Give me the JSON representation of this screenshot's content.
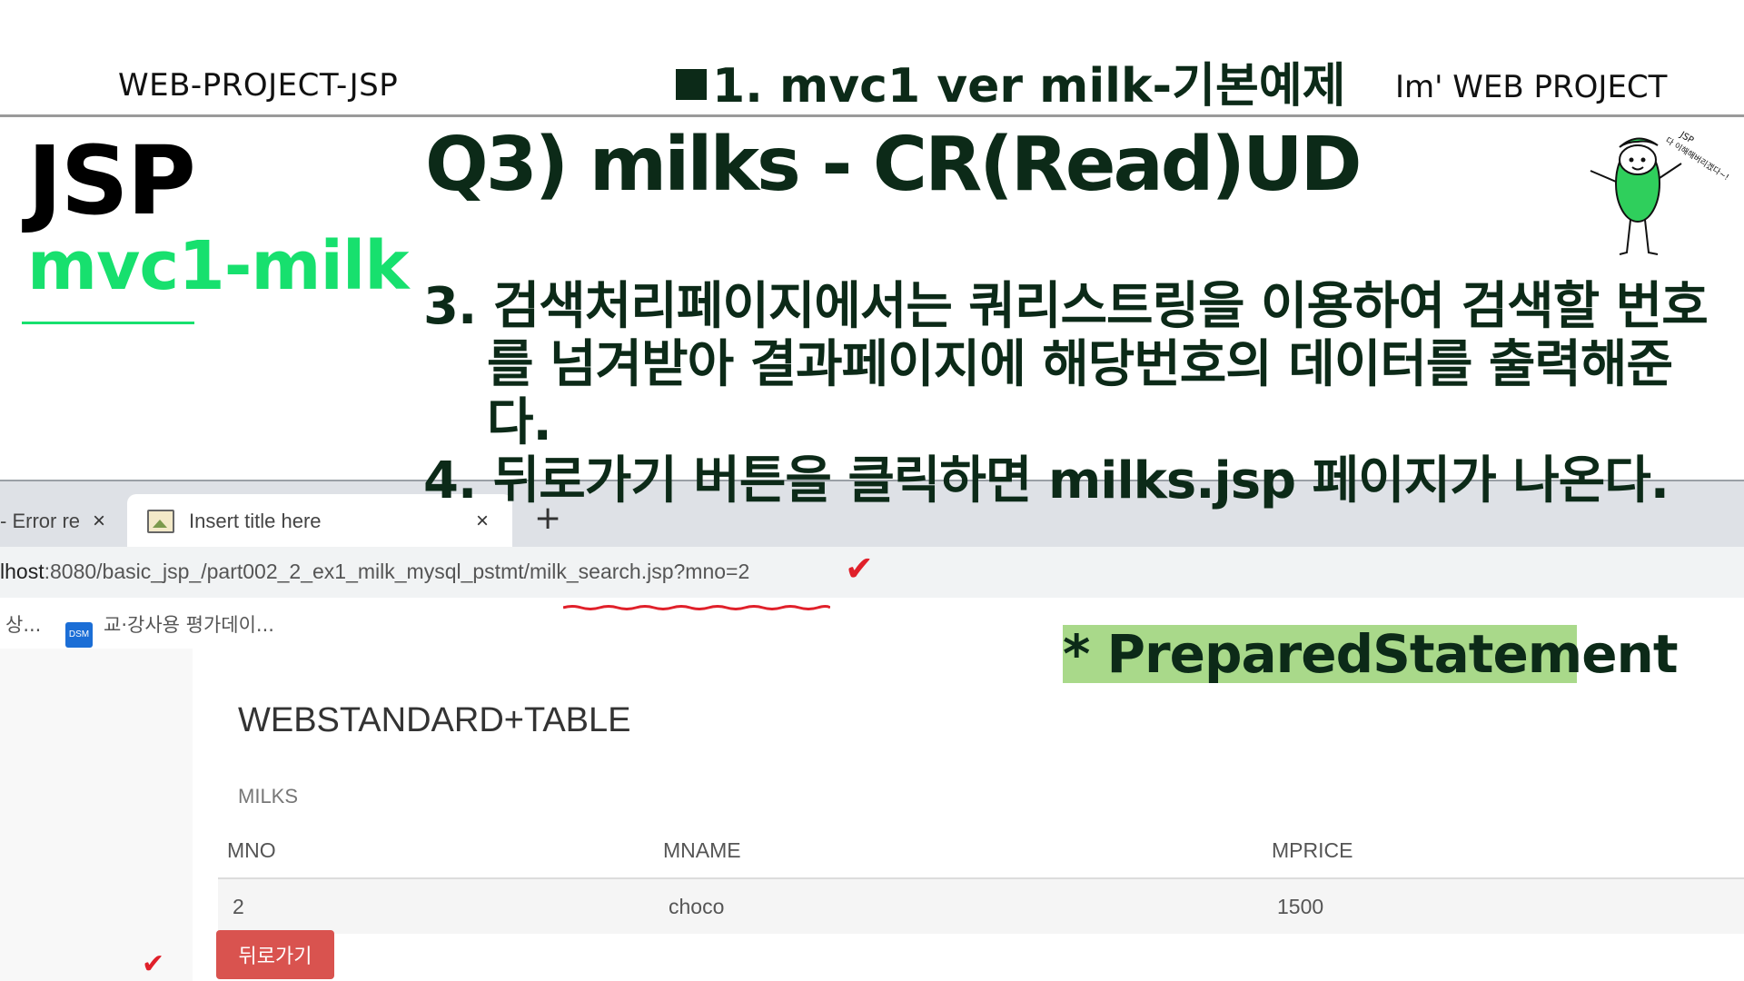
{
  "slide": {
    "header_left": "WEB-PROJECT-JSP",
    "header_center": "1. mvc1 ver  milk-기본예제",
    "header_right": "Im'  WEB PROJECT",
    "title": "JSP",
    "subtitle": "mvc1-milk",
    "question": "Q3) milks - CR(Read)UD",
    "items": [
      "3. 검색처리페이지에서는 쿼리스트링을 이용하여 검색할 번호를 넘겨받아 결과페이지에 해당번호의 데이터를 출력해준다.",
      "4. 뒤로가기 버튼을 클릭하면 milks.jsp 페이지가 나온다."
    ],
    "highlight": "* PreparedStatement",
    "mascot_caption": "JSP 다 이해해버리겠다~!"
  },
  "browser": {
    "tabs": [
      {
        "label": "- Error re",
        "close": "×"
      },
      {
        "label": "Insert title here",
        "close": "×"
      }
    ],
    "new_tab": "+",
    "url_host": "lhost",
    "url_rest": ":8080/basic_jsp_/part002_2_ex1_milk_mysql_pstmt/milk_search.jsp?mno=2",
    "bookmarks": [
      {
        "label": "상..."
      },
      {
        "icon": "DSM",
        "label": "교·강사용 평가데이..."
      }
    ]
  },
  "page": {
    "heading": "WEBSTANDARD+TABLE",
    "caption": "MILKS",
    "columns": [
      "MNO",
      "MNAME",
      "MPRICE"
    ],
    "rows": [
      [
        "2",
        "choco",
        "1500"
      ]
    ],
    "back_button": "뒤로가기"
  },
  "colors": {
    "accent_green": "#17e06e",
    "dark_green": "#0c2a18",
    "highlight": "#a9d98a",
    "button_red": "#d9534f"
  }
}
